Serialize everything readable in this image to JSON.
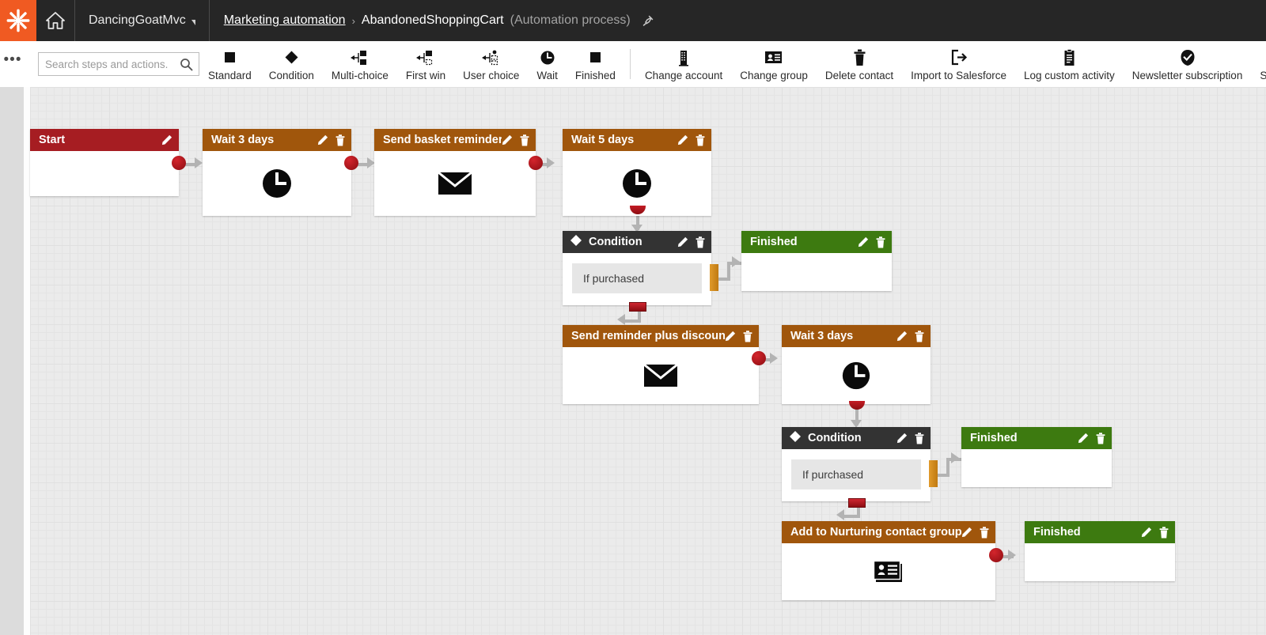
{
  "topbar": {
    "logo_icon": "kentico-asterisk-logo",
    "home_icon": "home-icon",
    "site_name": "DancingGoatMvc",
    "breadcrumb": {
      "parent": "Marketing automation",
      "separator": "›",
      "current": "AbandonedShoppingCart",
      "type": "(Automation process)",
      "pin_icon": "pin-icon"
    }
  },
  "toolbar": {
    "more_icon": "ellipsis-icon",
    "search": {
      "placeholder": "Search steps and actions.",
      "value": "",
      "icon": "search-icon"
    },
    "steps": [
      {
        "label": "Standard",
        "icon": "square-icon"
      },
      {
        "label": "Condition",
        "icon": "diamond-icon"
      },
      {
        "label": "Multi-choice",
        "icon": "multi-choice-icon"
      },
      {
        "label": "First win",
        "icon": "first-win-icon"
      },
      {
        "label": "User choice",
        "icon": "user-choice-icon"
      },
      {
        "label": "Wait",
        "icon": "clock-icon"
      },
      {
        "label": "Finished",
        "icon": "square-icon"
      }
    ],
    "actions": [
      {
        "label": "Change account",
        "icon": "building-icon"
      },
      {
        "label": "Change group",
        "icon": "contact-card-icon"
      },
      {
        "label": "Delete contact",
        "icon": "trash-icon"
      },
      {
        "label": "Import to Salesforce",
        "icon": "export-arrow-icon"
      },
      {
        "label": "Log custom activity",
        "icon": "clipboard-icon"
      },
      {
        "label": "Newsletter subscription",
        "icon": "check-badge-icon"
      },
      {
        "label": "Se",
        "icon": "truncated-icon"
      }
    ]
  },
  "canvas": {
    "nodes": [
      {
        "id": "start",
        "title": "Start",
        "type": "start",
        "icon": "none",
        "has_delete": false
      },
      {
        "id": "wait3a",
        "title": "Wait 3 days",
        "type": "step",
        "icon": "clock-icon",
        "has_delete": true
      },
      {
        "id": "basket",
        "title": "Send basket reminder",
        "type": "step",
        "icon": "envelope-icon",
        "has_delete": true
      },
      {
        "id": "wait5",
        "title": "Wait 5 days",
        "type": "step",
        "icon": "clock-icon",
        "has_delete": true
      },
      {
        "id": "cond1",
        "title": "Condition",
        "type": "condition",
        "icon": "diamond-icon",
        "case": "If purchased",
        "has_delete": true
      },
      {
        "id": "fin1",
        "title": "Finished",
        "type": "finished",
        "icon": "none",
        "has_delete": true
      },
      {
        "id": "discount",
        "title": "Send reminder plus discount",
        "type": "step",
        "icon": "envelope-icon",
        "has_delete": true
      },
      {
        "id": "wait3b",
        "title": "Wait 3 days",
        "type": "step",
        "icon": "clock-icon",
        "has_delete": true
      },
      {
        "id": "cond2",
        "title": "Condition",
        "type": "condition",
        "icon": "diamond-icon",
        "case": "If purchased",
        "has_delete": true
      },
      {
        "id": "fin2",
        "title": "Finished",
        "type": "finished",
        "icon": "none",
        "has_delete": true
      },
      {
        "id": "nurture",
        "title": "Add to Nurturing contact group",
        "type": "step",
        "icon": "contact-card-icon",
        "has_delete": true
      },
      {
        "id": "fin3",
        "title": "Finished",
        "type": "finished",
        "icon": "none",
        "has_delete": true
      }
    ],
    "edit_icon": "pencil-icon",
    "delete_icon": "trash-icon"
  },
  "colors": {
    "brand_orange": "#F05A22",
    "topbar_bg": "#262626",
    "start_header": "#A61D22",
    "step_header": "#A0560C",
    "finished_header": "#3D7A10",
    "condition_header": "#333333",
    "port_red": "#A61D22",
    "port_orange": "#C07A12"
  }
}
